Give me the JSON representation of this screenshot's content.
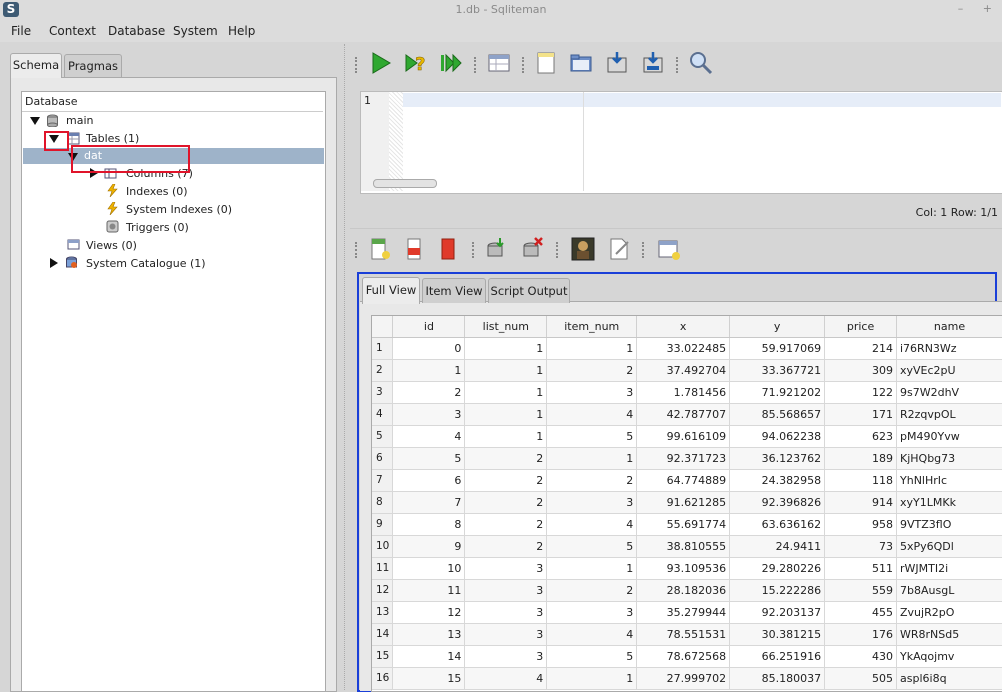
{
  "window": {
    "title": "1.db - Sqliteman",
    "logo": "S",
    "controls": "– +"
  },
  "menu": [
    {
      "label": "File"
    },
    {
      "label": "Context"
    },
    {
      "label": "Database"
    },
    {
      "label": "System"
    },
    {
      "label": "Help"
    }
  ],
  "left_tabs": {
    "schema": "Schema",
    "pragmas": "Pragmas"
  },
  "tree": {
    "header": "Database",
    "main": "main",
    "tables": "Tables (1)",
    "dat": "dat",
    "columns": "Columns (7)",
    "indexes": "Indexes (0)",
    "system_indexes": "System Indexes (0)",
    "triggers": "Triggers (0)",
    "views": "Views (0)",
    "system_catalogue": "System Catalogue (1)"
  },
  "editor": {
    "line_number": "1"
  },
  "status": "Col: 1 Row: 1/1",
  "result_tabs": {
    "full_view": "Full View",
    "item_view": "Item View",
    "script_output": "Script Output"
  },
  "colors": {
    "highlight_red": "#e0142a",
    "focus_blue": "#1a3fd8",
    "selection": "#9eb3c9"
  },
  "table": {
    "columns": [
      "id",
      "list_num",
      "item_num",
      "x",
      "y",
      "price",
      "name"
    ],
    "rows": [
      [
        "1",
        "0",
        "1",
        "1",
        "33.022485",
        "59.917069",
        "214",
        "i76RN3Wz"
      ],
      [
        "2",
        "1",
        "1",
        "2",
        "37.492704",
        "33.367721",
        "309",
        "xyVEc2pU"
      ],
      [
        "3",
        "2",
        "1",
        "3",
        "1.781456",
        "71.921202",
        "122",
        "9s7W2dhV"
      ],
      [
        "4",
        "3",
        "1",
        "4",
        "42.787707",
        "85.568657",
        "171",
        "R2zqvpOL"
      ],
      [
        "5",
        "4",
        "1",
        "5",
        "99.616109",
        "94.062238",
        "623",
        "pM490Yvw"
      ],
      [
        "6",
        "5",
        "2",
        "1",
        "92.371723",
        "36.123762",
        "189",
        "KjHQbg73"
      ],
      [
        "7",
        "6",
        "2",
        "2",
        "64.774889",
        "24.382958",
        "118",
        "YhNlHrIc"
      ],
      [
        "8",
        "7",
        "2",
        "3",
        "91.621285",
        "92.396826",
        "914",
        "xyY1LMKk"
      ],
      [
        "9",
        "8",
        "2",
        "4",
        "55.691774",
        "63.636162",
        "958",
        "9VTZ3flO"
      ],
      [
        "10",
        "9",
        "2",
        "5",
        "38.810555",
        "24.9411",
        "73",
        "5xPy6QDl"
      ],
      [
        "11",
        "10",
        "3",
        "1",
        "93.109536",
        "29.280226",
        "511",
        "rWJMTI2i"
      ],
      [
        "12",
        "11",
        "3",
        "2",
        "28.182036",
        "15.222286",
        "559",
        "7b8AusgL"
      ],
      [
        "13",
        "12",
        "3",
        "3",
        "35.279944",
        "92.203137",
        "455",
        "ZvujR2pO"
      ],
      [
        "14",
        "13",
        "3",
        "4",
        "78.551531",
        "30.381215",
        "176",
        "WR8rNSd5"
      ],
      [
        "15",
        "14",
        "3",
        "5",
        "78.672568",
        "66.251916",
        "430",
        "YkAqojmv"
      ],
      [
        "16",
        "15",
        "4",
        "1",
        "27.999702",
        "85.180037",
        "505",
        "aspl6i8q"
      ]
    ]
  }
}
